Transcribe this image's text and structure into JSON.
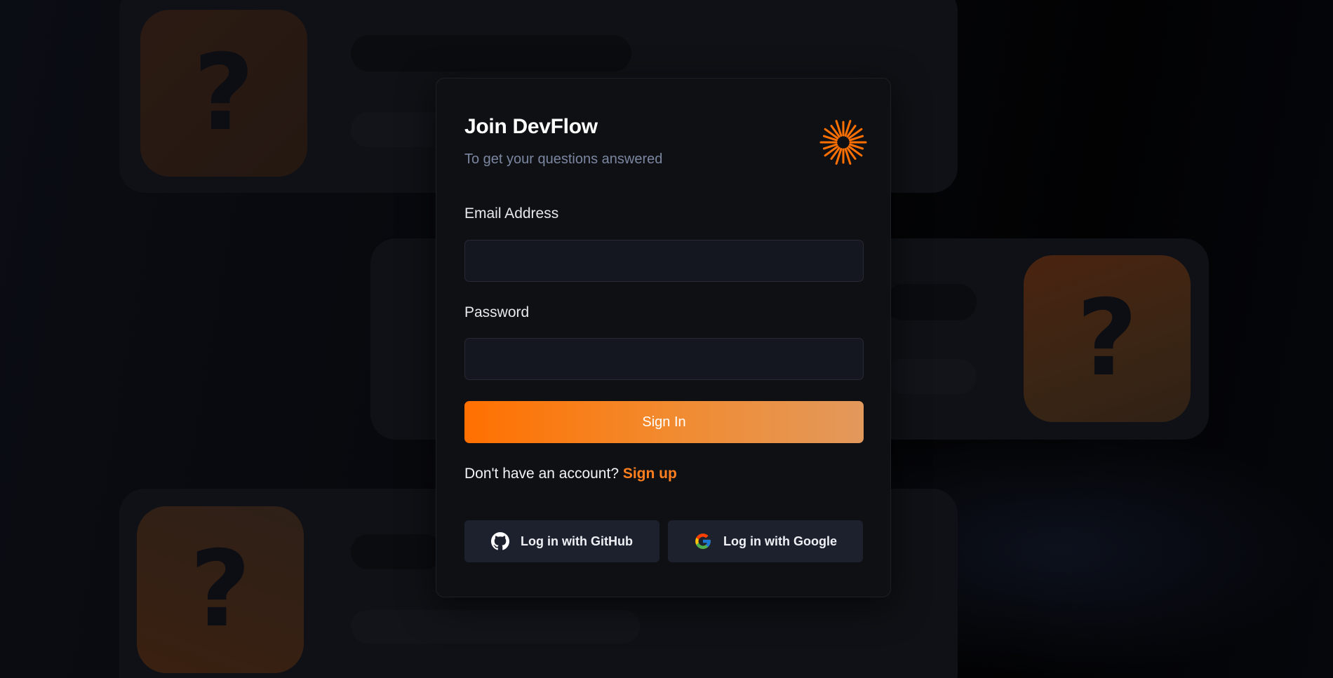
{
  "auth": {
    "title": "Join DevFlow",
    "subtitle": "To get your questions answered",
    "email_label": "Email Address",
    "email_value": "",
    "password_label": "Password",
    "password_value": "",
    "submit_label": "Sign In",
    "signup_prompt": "Don't have an account?",
    "signup_link": "Sign up",
    "github_label": "Log in with GitHub",
    "google_label": "Log in with Google"
  },
  "background": {
    "tile_glyph": "?"
  },
  "colors": {
    "accent": "#ff7000",
    "card_bg": "#0f1014",
    "input_bg": "#151720",
    "oauth_bg": "#1d212d"
  },
  "icons": [
    "logo-icon",
    "github-icon",
    "google-icon"
  ]
}
